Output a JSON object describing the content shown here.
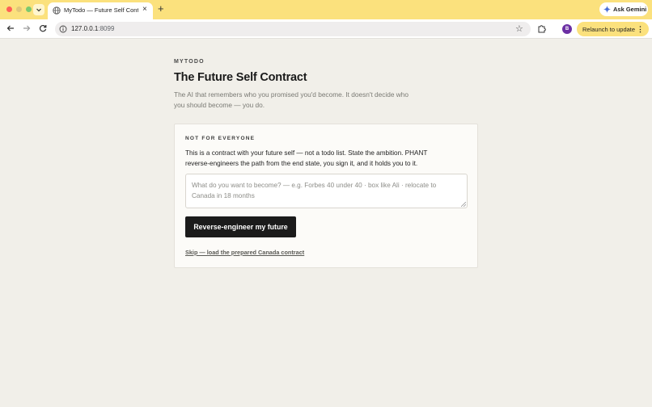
{
  "browser": {
    "tab_title": "MyTodo — Future Self Contra",
    "url_host": "127.0.0.1",
    "url_port": ":8099",
    "ask_gemini": "Ask Gemini",
    "relaunch_label": "Relaunch to update",
    "profile_initial": "B",
    "new_tab": "+",
    "close_tab": "×",
    "colors": {
      "tabstrip": "#fbe17d",
      "profile": "#6b2fa3"
    },
    "icons": [
      "back-arrow-icon",
      "forward-arrow-icon",
      "reload-icon",
      "site-info-icon",
      "star-icon",
      "extensions-icon",
      "gemini-sparkle-icon",
      "kebab-menu-icon",
      "globe-icon",
      "chevron-down-icon"
    ]
  },
  "page": {
    "eyebrow": "MYTODO",
    "title": "The Future Self Contract",
    "subtitle": "The AI that remembers who you promised you'd become. It doesn't decide who you should become — you do."
  },
  "card": {
    "eyebrow": "NOT FOR EVERYONE",
    "text": "This is a contract with your future self — not a todo list. State the ambition. PHANT reverse-engineers the path from the end state, you sign it, and it holds you to it.",
    "input_placeholder": "What do you want to become? — e.g. Forbes 40 under 40 · box like Ali · relocate to Canada in 18 months",
    "input_value": "",
    "cta_label": "Reverse-engineer my future",
    "skip_link": "Skip — load the prepared Canada contract"
  }
}
